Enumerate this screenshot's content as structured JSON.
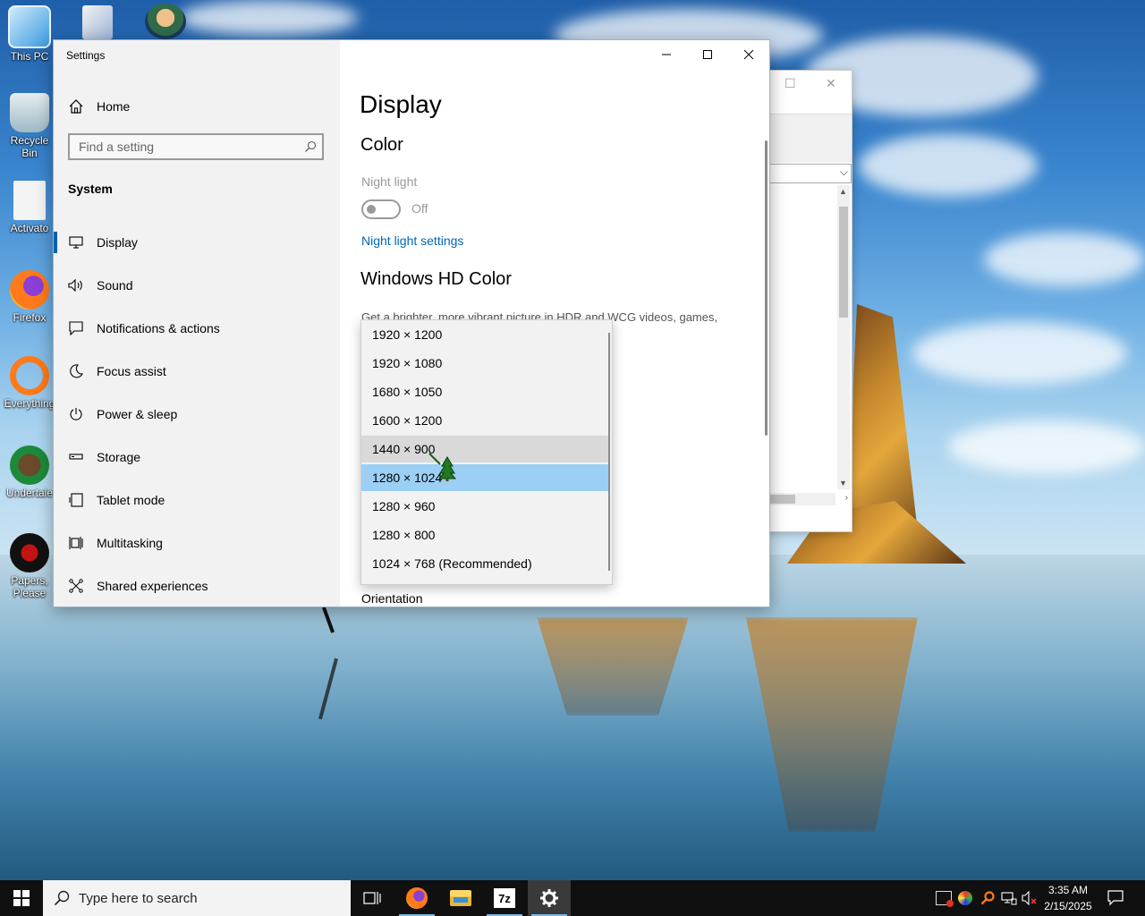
{
  "desktop": {
    "icons": [
      {
        "label": "This PC"
      },
      {
        "label": "Recycle Bin"
      },
      {
        "label": "Activato"
      },
      {
        "label": "Firefox"
      },
      {
        "label": "Everything"
      },
      {
        "label": "Undertale"
      },
      {
        "label": "Papers, Please"
      }
    ]
  },
  "settings": {
    "app_title": "Settings",
    "home_label": "Home",
    "search_placeholder": "Find a setting",
    "section_label": "System",
    "nav": [
      {
        "label": "Display",
        "icon": "monitor-icon",
        "active": true
      },
      {
        "label": "Sound",
        "icon": "speaker-icon"
      },
      {
        "label": "Notifications & actions",
        "icon": "notification-icon"
      },
      {
        "label": "Focus assist",
        "icon": "moon-icon"
      },
      {
        "label": "Power & sleep",
        "icon": "power-icon"
      },
      {
        "label": "Storage",
        "icon": "storage-icon"
      },
      {
        "label": "Tablet mode",
        "icon": "tablet-icon"
      },
      {
        "label": "Multitasking",
        "icon": "multitasking-icon"
      },
      {
        "label": "Shared experiences",
        "icon": "shared-experiences-icon"
      }
    ],
    "content": {
      "page_title": "Display",
      "color_heading": "Color",
      "night_light_label": "Night light",
      "night_light_state": "Off",
      "night_light_link": "Night light settings",
      "hd_color_heading": "Windows HD Color",
      "hd_color_desc": "Get a brighter, more vibrant picture in HDR and WCG videos, games,",
      "orientation_label": "Orientation"
    },
    "resolution_dropdown": {
      "options": [
        "1920 × 1200",
        "1920 × 1080",
        "1680 × 1050",
        "1600 × 1200",
        "1440 × 900",
        "1280 × 1024",
        "1280 × 960",
        "1280 × 800",
        "1024 × 768 (Recommended)"
      ],
      "hovered": "1440 × 900",
      "selected": "1280 × 1024"
    }
  },
  "taskbar": {
    "search_placeholder": "Type here to search",
    "time": "3:35 AM",
    "date": "2/15/2025"
  },
  "colors": {
    "accent": "#0063b1",
    "link": "#0067b8",
    "selection": "#9ccff4",
    "taskbar": "#101010"
  }
}
